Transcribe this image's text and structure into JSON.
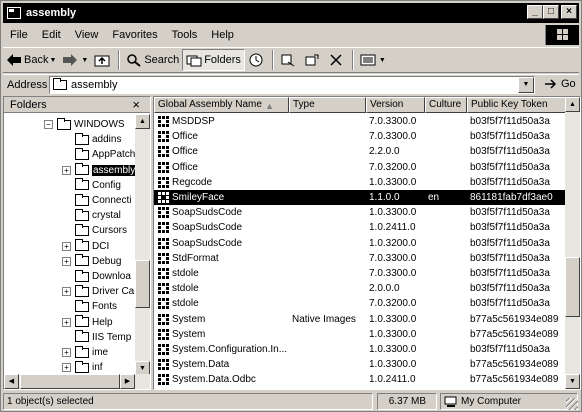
{
  "window": {
    "title": "assembly",
    "buttons": {
      "minimize": "_",
      "maximize": "□",
      "close": "×"
    }
  },
  "menu": [
    "File",
    "Edit",
    "View",
    "Favorites",
    "Tools",
    "Help"
  ],
  "toolbar": {
    "back": "Back",
    "search": "Search",
    "folders": "Folders"
  },
  "address": {
    "label": "Address",
    "value": "assembly",
    "go": "Go"
  },
  "folders_pane": {
    "title": "Folders",
    "close": "×",
    "items": [
      {
        "label": "WINDOWS",
        "expander": "−",
        "selected": false
      },
      {
        "label": "addins",
        "expander": "",
        "selected": false
      },
      {
        "label": "AppPatch",
        "expander": "",
        "selected": false
      },
      {
        "label": "assembly",
        "expander": "+",
        "selected": true
      },
      {
        "label": "Config",
        "expander": "",
        "selected": false
      },
      {
        "label": "Connecti",
        "expander": "",
        "selected": false
      },
      {
        "label": "crystal",
        "expander": "",
        "selected": false
      },
      {
        "label": "Cursors",
        "expander": "",
        "selected": false
      },
      {
        "label": "DCI",
        "expander": "+",
        "selected": false
      },
      {
        "label": "Debug",
        "expander": "+",
        "selected": false
      },
      {
        "label": "Downloa",
        "expander": "",
        "selected": false
      },
      {
        "label": "Driver Ca",
        "expander": "+",
        "selected": false
      },
      {
        "label": "Fonts",
        "expander": "",
        "selected": false
      },
      {
        "label": "Help",
        "expander": "+",
        "selected": false
      },
      {
        "label": "IIS Temp",
        "expander": "",
        "selected": false
      },
      {
        "label": "ime",
        "expander": "+",
        "selected": false
      },
      {
        "label": "inf",
        "expander": "+",
        "selected": false
      }
    ]
  },
  "list": {
    "columns": [
      "Global Assembly Name",
      "Type",
      "Version",
      "Culture",
      "Public Key Token"
    ],
    "rows": [
      {
        "name": "MSDDSP",
        "type": "",
        "version": "7.0.3300.0",
        "culture": "",
        "token": "b03f5f7f11d50a3a",
        "selected": false
      },
      {
        "name": "Office",
        "type": "",
        "version": "7.0.3300.0",
        "culture": "",
        "token": "b03f5f7f11d50a3a",
        "selected": false
      },
      {
        "name": "Office",
        "type": "",
        "version": "2.2.0.0",
        "culture": "",
        "token": "b03f5f7f11d50a3a",
        "selected": false
      },
      {
        "name": "Office",
        "type": "",
        "version": "7.0.3200.0",
        "culture": "",
        "token": "b03f5f7f11d50a3a",
        "selected": false
      },
      {
        "name": "Regcode",
        "type": "",
        "version": "1.0.3300.0",
        "culture": "",
        "token": "b03f5f7f11d50a3a",
        "selected": false
      },
      {
        "name": "SmileyFace",
        "type": "",
        "version": "1.1.0.0",
        "culture": "en",
        "token": "861181fab7df3ae0",
        "selected": true
      },
      {
        "name": "SoapSudsCode",
        "type": "",
        "version": "1.0.3300.0",
        "culture": "",
        "token": "b03f5f7f11d50a3a",
        "selected": false
      },
      {
        "name": "SoapSudsCode",
        "type": "",
        "version": "1.0.2411.0",
        "culture": "",
        "token": "b03f5f7f11d50a3a",
        "selected": false
      },
      {
        "name": "SoapSudsCode",
        "type": "",
        "version": "1.0.3200.0",
        "culture": "",
        "token": "b03f5f7f11d50a3a",
        "selected": false
      },
      {
        "name": "StdFormat",
        "type": "",
        "version": "7.0.3300.0",
        "culture": "",
        "token": "b03f5f7f11d50a3a",
        "selected": false
      },
      {
        "name": "stdole",
        "type": "",
        "version": "7.0.3300.0",
        "culture": "",
        "token": "b03f5f7f11d50a3a",
        "selected": false
      },
      {
        "name": "stdole",
        "type": "",
        "version": "2.0.0.0",
        "culture": "",
        "token": "b03f5f7f11d50a3a",
        "selected": false
      },
      {
        "name": "stdole",
        "type": "",
        "version": "7.0.3200.0",
        "culture": "",
        "token": "b03f5f7f11d50a3a",
        "selected": false
      },
      {
        "name": "System",
        "type": "Native Images",
        "version": "1.0.3300.0",
        "culture": "",
        "token": "b77a5c561934e089",
        "selected": false
      },
      {
        "name": "System",
        "type": "",
        "version": "1.0.3300.0",
        "culture": "",
        "token": "b77a5c561934e089",
        "selected": false
      },
      {
        "name": "System.Configuration.In...",
        "type": "",
        "version": "1.0.3300.0",
        "culture": "",
        "token": "b03f5f7f11d50a3a",
        "selected": false
      },
      {
        "name": "System.Data",
        "type": "",
        "version": "1.0.3300.0",
        "culture": "",
        "token": "b77a5c561934e089",
        "selected": false
      },
      {
        "name": "System.Data.Odbc",
        "type": "",
        "version": "1.0.2411.0",
        "culture": "",
        "token": "b77a5c561934e089",
        "selected": false
      }
    ]
  },
  "status": {
    "selection": "1 object(s) selected",
    "size": "6.37 MB",
    "zone": "My Computer"
  }
}
